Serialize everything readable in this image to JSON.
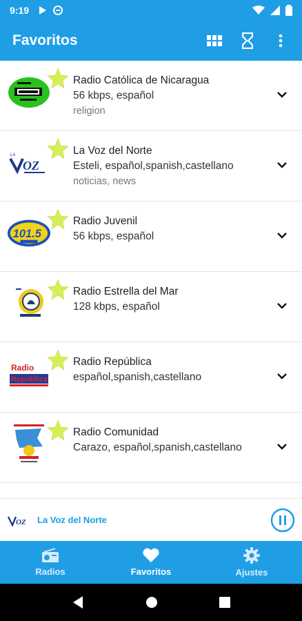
{
  "status_bar": {
    "time": "9:19"
  },
  "app_bar": {
    "title": "Favoritos"
  },
  "stations": [
    {
      "name": "Radio Católica de Nicaragua",
      "detail": "56 kbps, español",
      "tags": "religion",
      "logo": "catolica-logo"
    },
    {
      "name": "La Voz del Norte",
      "detail": "Esteli, español,spanish,castellano",
      "tags": "noticias, news",
      "logo": "lavoz-logo"
    },
    {
      "name": "Radio Juvenil",
      "detail": "56 kbps, español",
      "tags": "",
      "logo": "juvenil-logo"
    },
    {
      "name": "Radio Estrella del Mar",
      "detail": "128 kbps, español",
      "tags": "",
      "logo": "estrella-logo"
    },
    {
      "name": "Radio República",
      "detail": "español,spanish,castellano",
      "tags": "",
      "logo": "republica-logo"
    },
    {
      "name": "Radio Comunidad",
      "detail": "Carazo, español,spanish,castellano",
      "tags": "",
      "logo": "comunidad-logo"
    }
  ],
  "player": {
    "station_name": "La Voz del Norte"
  },
  "bottom_nav": [
    {
      "label": "Radios",
      "icon": "radio-icon",
      "active": false
    },
    {
      "label": "Favoritos",
      "icon": "heart-icon",
      "active": true
    },
    {
      "label": "Ajustes",
      "icon": "gear-icon",
      "active": false
    }
  ],
  "colors": {
    "primary": "#1f9ee6",
    "star": "#d7ee58"
  }
}
